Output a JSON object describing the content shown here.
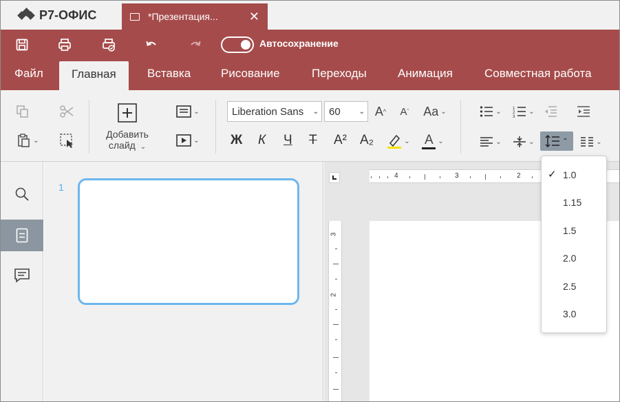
{
  "app": {
    "name": "Р7-ОФИС"
  },
  "tab": {
    "title": "*Презентация...",
    "close": "✕"
  },
  "quick_access": {
    "autosave_label": "Автосохранение",
    "autosave_on": true
  },
  "menu": {
    "items": [
      {
        "label": "Файл"
      },
      {
        "label": "Главная",
        "active": true
      },
      {
        "label": "Вставка"
      },
      {
        "label": "Рисование"
      },
      {
        "label": "Переходы"
      },
      {
        "label": "Анимация"
      },
      {
        "label": "Совместная работа"
      }
    ]
  },
  "toolbar": {
    "add_slide_line1": "Добавить",
    "add_slide_line2": "слайд",
    "font_name": "Liberation Sans",
    "font_size": "60",
    "bold": "Ж",
    "italic": "К",
    "underline": "Ч",
    "strike": "Т",
    "superscript": "A²",
    "subscript": "A₂",
    "grow": "A",
    "shrink": "A",
    "change_case": "Aa",
    "font_color_letter": "A",
    "highlight_color": "#f5e300",
    "font_color": "#222222"
  },
  "slides": {
    "numbers": [
      "1"
    ]
  },
  "ruler": {
    "h_numbers": [
      "4",
      "3",
      "2"
    ],
    "v_numbers": [
      "3",
      "2"
    ]
  },
  "line_spacing_menu": {
    "items": [
      {
        "label": "1.0",
        "checked": true
      },
      {
        "label": "1.15"
      },
      {
        "label": "1.5"
      },
      {
        "label": "2.0"
      },
      {
        "label": "2.5"
      },
      {
        "label": "3.0"
      }
    ],
    "check_mark": "✓"
  },
  "colors": {
    "header": "#a64b4b",
    "panel": "#f1f1f1",
    "accent": "#6cb6ee",
    "selected": "#8b96a0"
  }
}
